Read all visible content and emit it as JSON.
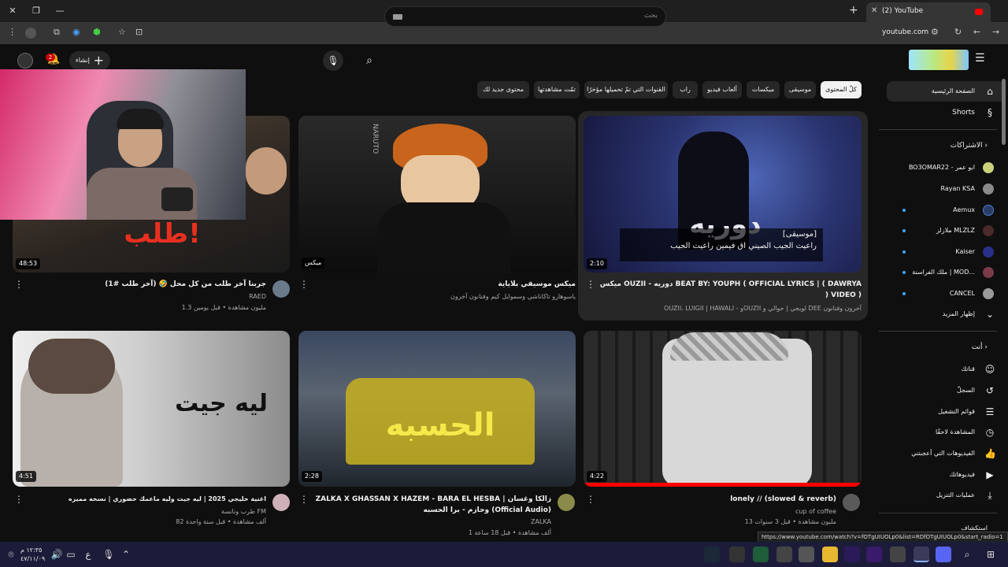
{
  "browser": {
    "tab_title": "(2) YouTube",
    "url": "youtube.com",
    "new_tab": "+"
  },
  "header": {
    "search_placeholder": "بحث",
    "create_label": "إنشاء",
    "notifications_count": "2"
  },
  "chips": [
    {
      "label": "كلّ المحتوى",
      "active": true
    },
    {
      "label": "موسيقى"
    },
    {
      "label": "ميكسات"
    },
    {
      "label": "ألعاب فيديو"
    },
    {
      "label": "راب"
    },
    {
      "label": "القنوات التي تمّ تحميلها مؤخرًا"
    },
    {
      "label": "تمّت مشاهدتها"
    },
    {
      "label": "محتوى جديد لك"
    }
  ],
  "sidebar": {
    "home": "الصفحة الرئيسية",
    "shorts": "Shorts",
    "subscriptions_header": "الاشتراكات",
    "subscriptions": [
      {
        "name": "BO3OMAR22 - ابو عمر",
        "dot": false,
        "color": "#c9d27a"
      },
      {
        "name": "Rayan KSA",
        "dot": false,
        "color": "#8a8a8a"
      },
      {
        "name": "Aemux",
        "dot": true,
        "color": "#2a3c66"
      },
      {
        "name": "ملازلز MLZLZ",
        "dot": true,
        "color": "#4a2a2a"
      },
      {
        "name": "Kaiser",
        "dot": true,
        "color": "#2a2f8a"
      },
      {
        "name": "ملك الفراسنة | MOD...",
        "dot": true,
        "color": "#7a3a4a"
      },
      {
        "name": "CANCEL",
        "dot": true,
        "color": "#9a9a9a"
      }
    ],
    "show_more": "إظهار المزيد",
    "you_header": "أنت",
    "you_items": [
      {
        "label": "قناتك",
        "icon": "☺"
      },
      {
        "label": "السجلّ",
        "icon": "↺"
      },
      {
        "label": "قوائم التشغيل",
        "icon": "☰"
      },
      {
        "label": "المشاهدة لاحقًا",
        "icon": "◷"
      },
      {
        "label": "الفيديوهات التي أعجبتني",
        "icon": "👍"
      },
      {
        "label": "فيديوهاتك",
        "icon": "▶"
      },
      {
        "label": "عمليات التنزيل",
        "icon": "⤓"
      }
    ],
    "explore_header": "استكشاف"
  },
  "videos": [
    {
      "title": "ميكس OUZII - دوريه BEAT BY: YOUPH ( OFFICIAL LYRICS | ( DAWRYA ) VIDEO )",
      "channel": "OUZII، LUIGII | HAWALI - وOUZII لويجي | حوالي و DEE آخرون وفنانون",
      "meta": "",
      "duration": "2:10",
      "overlay_tag": "[موسيقى]",
      "overlay_text": "راعيت الجيب الصيني اق فيمين راعيت الجيب"
    },
    {
      "title": "ميكس موسيقي بلاياية",
      "channel": "ياسوهارو تاكاناشي وسموايل كيم وفنانون آخرون",
      "meta": "",
      "duration": "ميكس",
      "thumb_text": "NARUTO"
    },
    {
      "title": "جربنا آخر طلب من كل محل 🤣 (آخر طلب #1)",
      "channel": "RAED",
      "meta": "1.3 مليون مشاهدة • قبل يومين",
      "duration": "48:53"
    },
    {
      "title": "lonely // (slowed & reverb)",
      "channel": "cup of coffee",
      "meta": "13 مليون مشاهدة • قبل 3 سنوات",
      "duration": "4:22"
    },
    {
      "title": "ZALKA X GHASSAN X HAZEM - BARA EL HESBA | زالكا وغسان وحازم - برا الحسبه (Official Audio)",
      "channel": "ZALKA",
      "meta": "1 ألف مشاهدة • قبل 18 ساعة",
      "duration": "2:28"
    },
    {
      "title": "اغنية خليجي 2025 | ليه جيت وليه ماعمك حضوري | نسخه مميزه",
      "channel": "طرب ونانسة FM",
      "meta": "82 ألف مشاهدة • قبل سنة واحدة",
      "duration": "4:51",
      "thumb_text": "ليه جيت"
    }
  ],
  "status_url": "https://www.youtube.com/watch?v=fOTgUIUOLp0&list=RDfOTgUIUOLp0&start_radio=1",
  "taskbar": {
    "time": "١٢:٣٥ م",
    "date": "٤٧/١١/٠٩",
    "lang": "ع"
  }
}
